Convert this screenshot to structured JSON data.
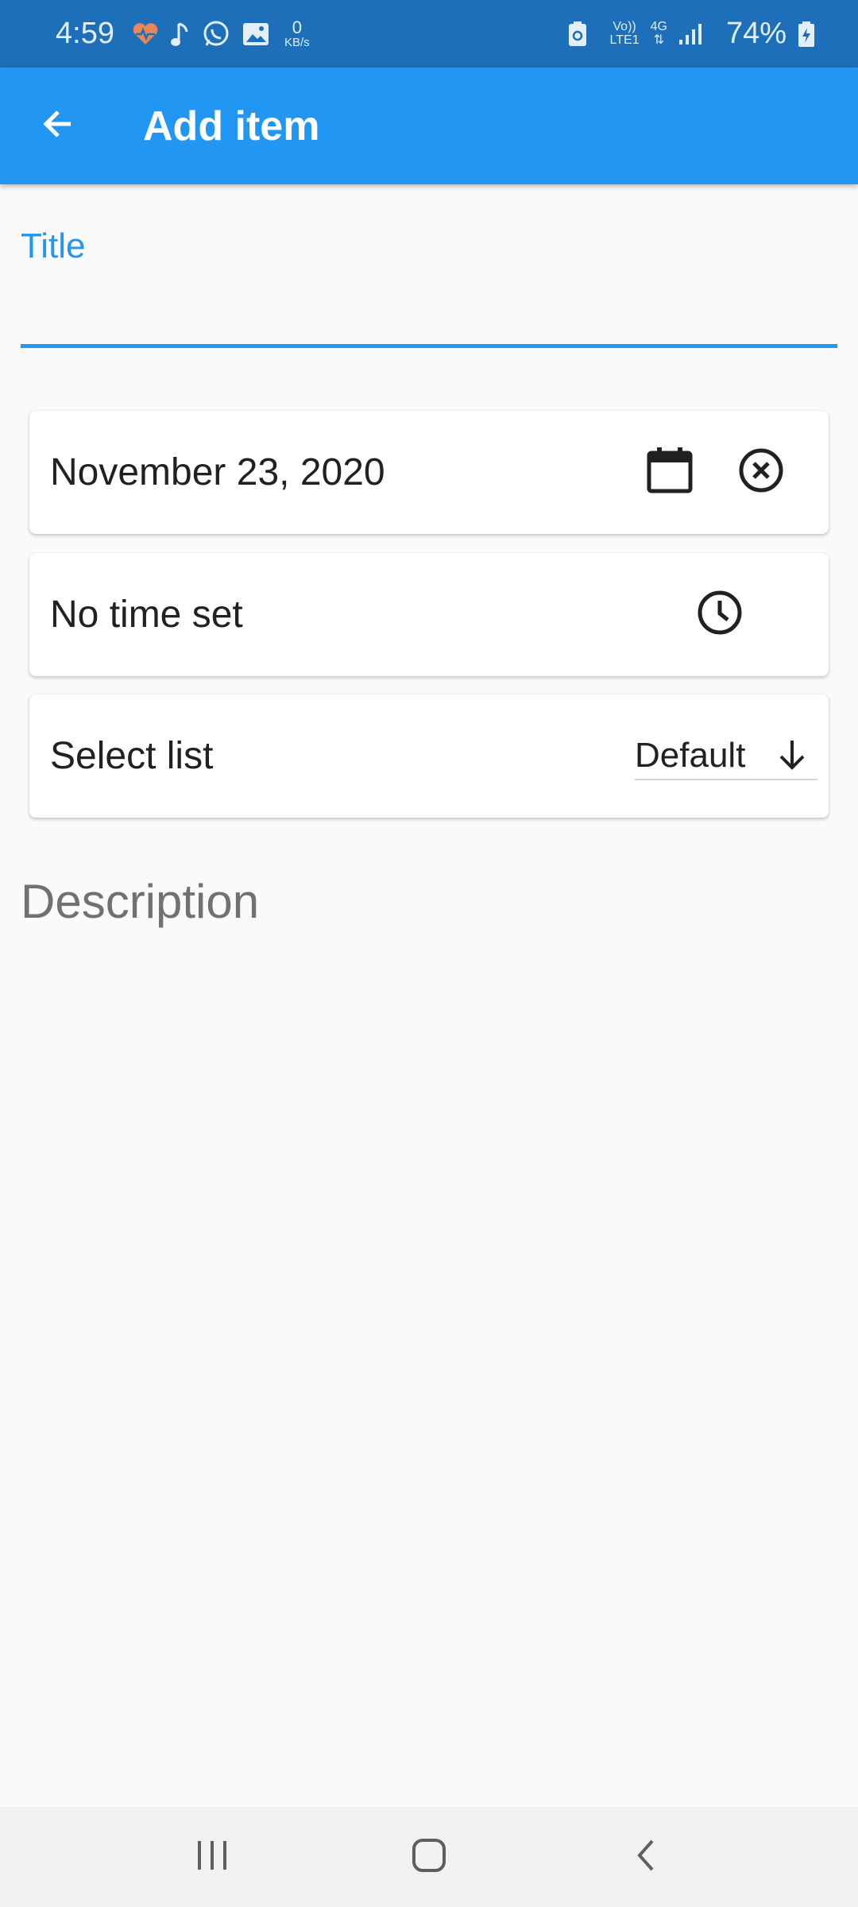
{
  "status_bar": {
    "time": "4:59",
    "net_speed_value": "0",
    "net_speed_unit": "KB/s",
    "volte_top": "Vo))",
    "volte_bottom": "LTE1",
    "network_type": "4G",
    "battery_percent": "74%",
    "icons": [
      "heart-rate-icon",
      "music-note-icon",
      "whatsapp-icon",
      "gallery-icon",
      "battery-saver-icon",
      "signal-icon",
      "battery-charging-icon"
    ]
  },
  "app_bar": {
    "title": "Add item",
    "back_icon": "arrow-left-icon"
  },
  "title_field": {
    "label": "Title",
    "value": ""
  },
  "date_card": {
    "text": "November 23, 2020",
    "calendar_icon": "calendar-icon",
    "clear_icon": "close-circle-icon"
  },
  "time_card": {
    "text": "No time set",
    "clock_icon": "clock-icon"
  },
  "list_card": {
    "label": "Select list",
    "selected": "Default",
    "dropdown_icon": "arrow-down-icon"
  },
  "description": {
    "placeholder": "Description",
    "value": ""
  },
  "colors": {
    "app_bar": "#2196f3",
    "status_bar": "#1c6fb8",
    "accent": "#2196f3",
    "background": "#fafafa"
  },
  "nav_bar": {
    "icons": [
      "recent-apps-icon",
      "home-icon",
      "back-icon"
    ]
  }
}
